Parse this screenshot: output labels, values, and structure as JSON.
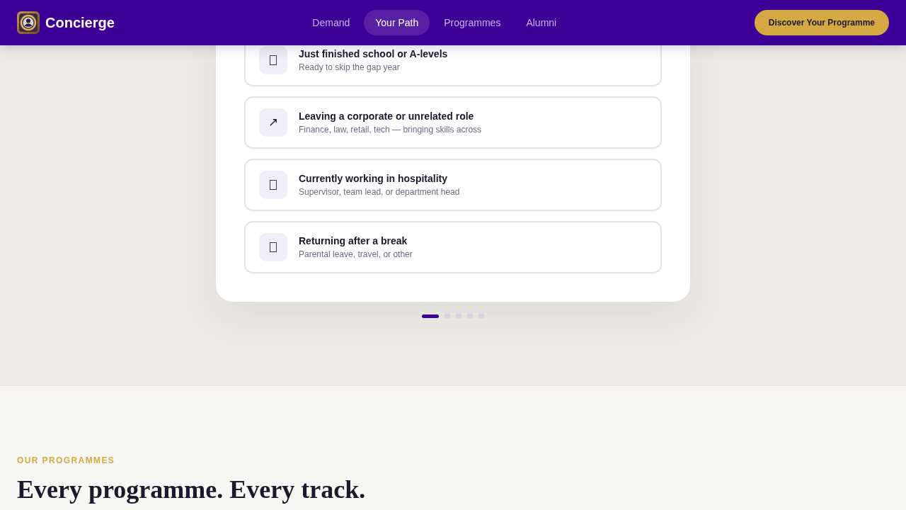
{
  "header": {
    "brand": "Concierge",
    "nav": [
      {
        "label": "Demand",
        "selected": false
      },
      {
        "label": "Your Path",
        "selected": true
      },
      {
        "label": "Programmes",
        "selected": false
      },
      {
        "label": "Alumni",
        "selected": false
      }
    ],
    "cta": "Discover Your Programme"
  },
  "path_card": {
    "options": [
      {
        "kind": "blank",
        "title": "Just finished school or A-levels",
        "subtitle": "Ready to skip the gap year"
      },
      {
        "kind": "glyph",
        "icon": "↗",
        "title": "Leaving a corporate or unrelated role",
        "subtitle": "Finance, law, retail, tech — bringing skills across"
      },
      {
        "kind": "blank",
        "title": "Currently working in hospitality",
        "subtitle": "Supervisor, team lead, or department head"
      },
      {
        "kind": "blank",
        "title": "Returning after a break",
        "subtitle": "Parental leave, travel, or other"
      }
    ]
  },
  "carousel_dots": [
    {
      "selected": true
    },
    {
      "selected": false
    },
    {
      "selected": false
    },
    {
      "selected": false
    },
    {
      "selected": false
    }
  ],
  "programmes": {
    "eyebrow": "OUR PROGRAMMES",
    "heading": "Every programme. Every track."
  }
}
